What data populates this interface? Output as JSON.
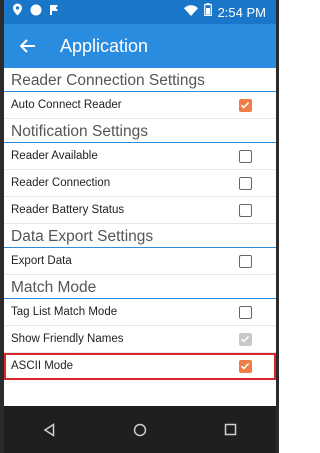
{
  "status_bar": {
    "time": "2:54 PM"
  },
  "app_bar": {
    "title": "Application"
  },
  "sections": [
    {
      "header": "Reader Connection Settings",
      "rows": [
        {
          "label": "Auto Connect Reader",
          "checked": true,
          "disabled": false
        }
      ]
    },
    {
      "header": "Notification Settings",
      "rows": [
        {
          "label": "Reader Available",
          "checked": false,
          "disabled": false
        },
        {
          "label": "Reader Connection",
          "checked": false,
          "disabled": false
        },
        {
          "label": "Reader Battery Status",
          "checked": false,
          "disabled": false
        }
      ]
    },
    {
      "header": "Data Export Settings",
      "rows": [
        {
          "label": "Export Data",
          "checked": false,
          "disabled": false
        }
      ]
    },
    {
      "header": "Match Mode",
      "rows": [
        {
          "label": "Tag List Match Mode",
          "checked": false,
          "disabled": false
        },
        {
          "label": "Show Friendly Names",
          "checked": true,
          "disabled": true
        },
        {
          "label": "ASCII Mode",
          "checked": true,
          "disabled": false,
          "highlighted": true
        }
      ]
    }
  ],
  "colors": {
    "status_bar": "#1a76c9",
    "app_bar": "#2a8cde",
    "accent": "#ee7d48",
    "highlight": "#d9252b",
    "nav_bar": "#1f1f1f"
  }
}
